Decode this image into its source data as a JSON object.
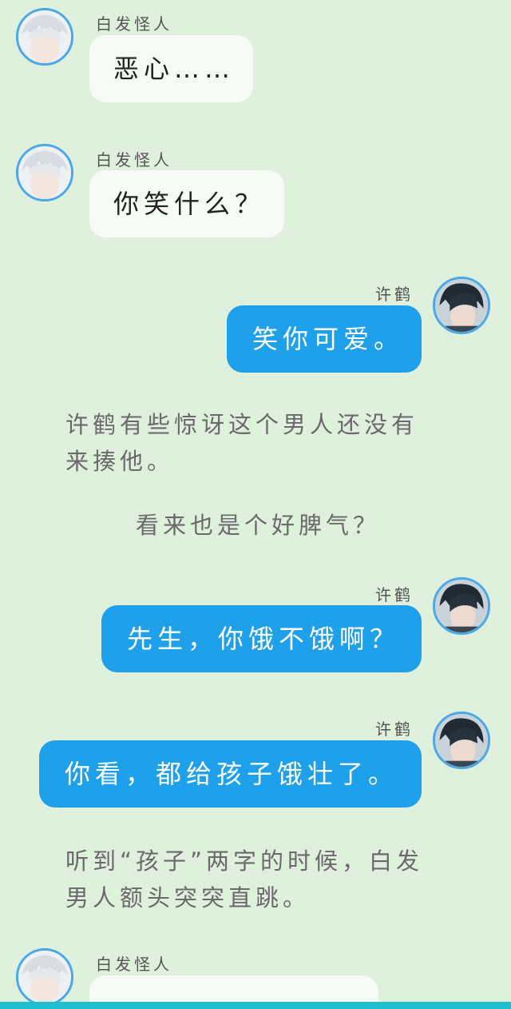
{
  "colors": {
    "background": "#dff0dc",
    "left_bubble": "#f6fbf5",
    "right_bubble": "#1ea0ea",
    "avatar_ring": "#4aa8e8",
    "bottom_bar": "#1fbecc"
  },
  "messages": [
    {
      "side": "left",
      "sender": "白发怪人",
      "text": "恶心……",
      "avatar": "white-hair-avatar"
    },
    {
      "side": "left",
      "sender": "白发怪人",
      "text": "你笑什么？",
      "avatar": "white-hair-avatar"
    },
    {
      "side": "right",
      "sender": "许鹤",
      "text": "笑你可爱。",
      "avatar": "dark-hair-avatar"
    },
    {
      "side": "right",
      "sender": "许鹤",
      "text": "先生，你饿不饿啊？",
      "avatar": "dark-hair-avatar"
    },
    {
      "side": "right",
      "sender": "许鹤",
      "text": "你看，都给孩子饿壮了。",
      "avatar": "dark-hair-avatar"
    },
    {
      "side": "left",
      "sender": "白发怪人",
      "text": "",
      "avatar": "white-hair-avatar"
    }
  ],
  "narration": [
    {
      "lines": [
        "许鹤有些惊讶这个男人还没有",
        "来揍他。"
      ]
    },
    {
      "lines": [
        "看来也是个好脾气？"
      ]
    },
    {
      "lines": [
        "听到“孩子”两字的时候，白发",
        "男人额头突突直跳。"
      ]
    }
  ]
}
